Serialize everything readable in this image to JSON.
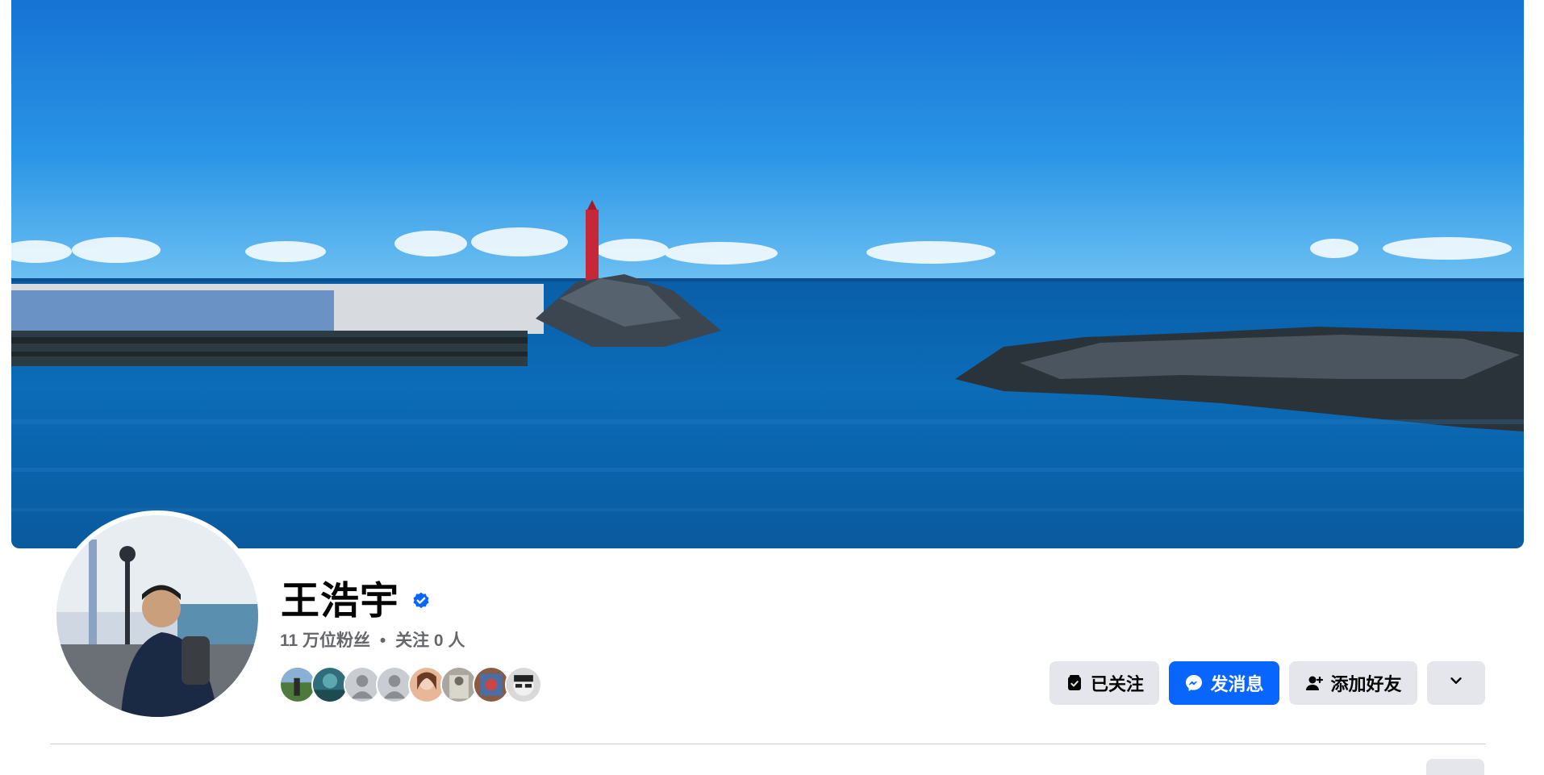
{
  "profile": {
    "name": "王浩宇",
    "verified": true,
    "followers_label": "11 万位粉丝",
    "separator": "•",
    "following_label": "关注 0 人",
    "mutual_friend_count_shown": 8
  },
  "actions": {
    "following_label": "已关注",
    "message_label": "发消息",
    "add_friend_label": "添加好友",
    "more_icon": "chevron-down-icon"
  },
  "colors": {
    "primary_blue": "#0866ff",
    "button_grey": "#e4e6eb",
    "secondary_text": "#65676b",
    "verified_badge": "#0866ff"
  },
  "icons": {
    "verified": "verified-badge-icon",
    "following": "following-check-icon",
    "message": "messenger-icon",
    "add_friend": "add-friend-icon"
  }
}
